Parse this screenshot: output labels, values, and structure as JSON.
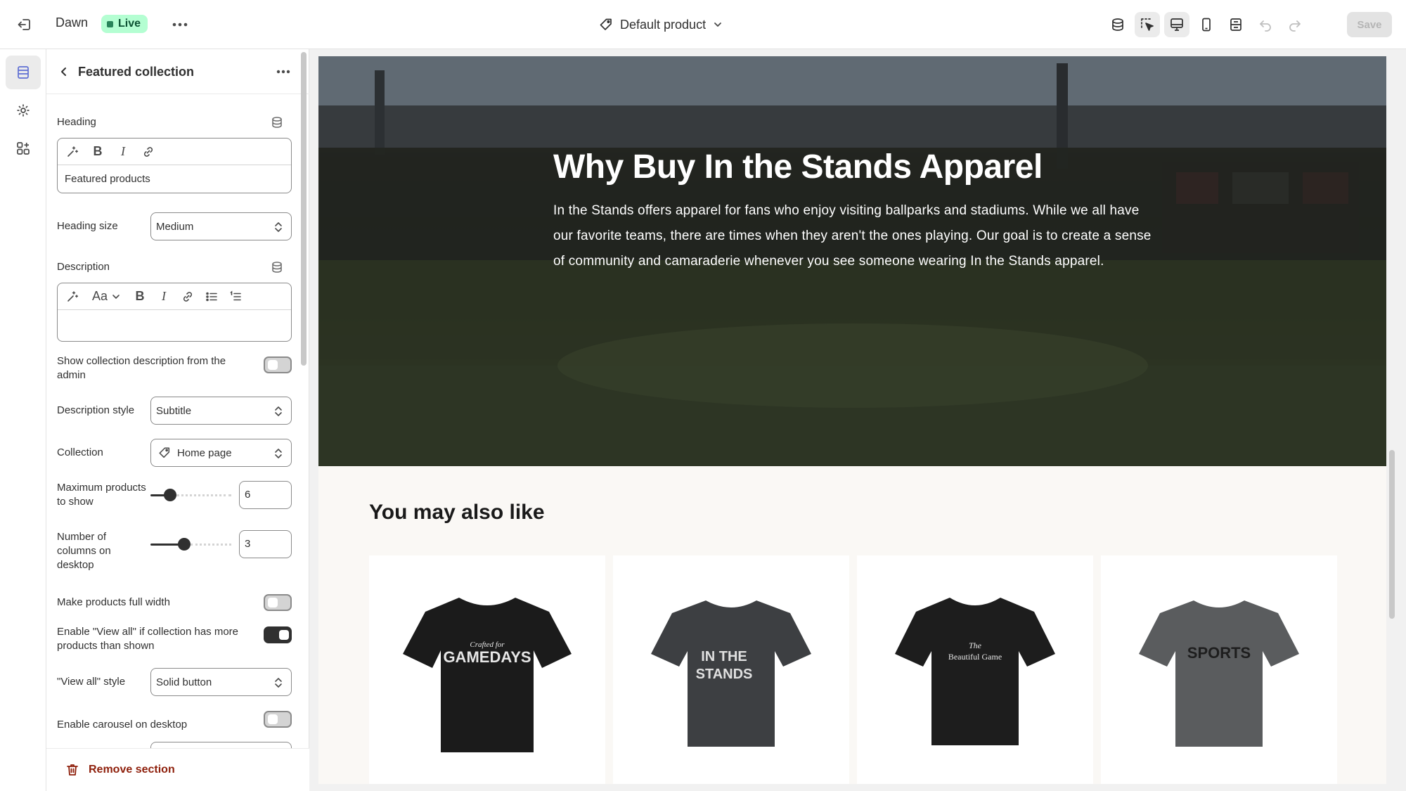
{
  "topbar": {
    "theme_name": "Dawn",
    "live_badge": "Live",
    "template_selector": "Default product",
    "save_label": "Save"
  },
  "panel": {
    "title": "Featured collection",
    "heading_label": "Heading",
    "heading_value": "Featured products",
    "heading_size_label": "Heading size",
    "heading_size_value": "Medium",
    "description_label": "Description",
    "description_format": "Aa",
    "show_description_label": "Show collection description from the admin",
    "description_style_label": "Description style",
    "description_style_value": "Subtitle",
    "collection_label": "Collection",
    "collection_value": "Home page",
    "max_products_label": "Maximum products to show",
    "max_products_value": "6",
    "columns_label": "Number of columns on desktop",
    "columns_value": "3",
    "full_width_label": "Make products full width",
    "view_all_label": "Enable \"View all\" if collection has more products than shown",
    "view_all_style_label": "\"View all\" style",
    "view_all_style_value": "Solid button",
    "carousel_label": "Enable carousel on desktop",
    "remove_label": "Remove section"
  },
  "controls": {
    "show_description_on": false,
    "full_width_on": false,
    "view_all_on": true,
    "carousel_on": false,
    "max_products_fraction": 0.2,
    "columns_fraction": 0.4
  },
  "preview": {
    "hero_title": "Why Buy In the Stands Apparel",
    "hero_text": "In the Stands offers apparel for fans who enjoy visiting ballparks and stadiums. While we all have our favorite teams, there are times when they aren't the ones playing. Our goal is to create a sense of community and camaraderie whenever you see someone wearing In the Stands apparel.",
    "section_heading": "You may also like",
    "products": [
      {
        "shirt_text_1": "Crafted for",
        "shirt_text_2": "GAMEDAYS",
        "color": "#1b1b1b"
      },
      {
        "shirt_text_1": "IN THE",
        "shirt_text_2": "STANDS",
        "color": "#3d3f42"
      },
      {
        "shirt_text_1": "The",
        "shirt_text_2": "Beautiful Game",
        "color": "#1d1d1d"
      },
      {
        "shirt_text_1": "SPORTS",
        "shirt_text_2": "",
        "color": "#5a5c5e"
      }
    ]
  }
}
